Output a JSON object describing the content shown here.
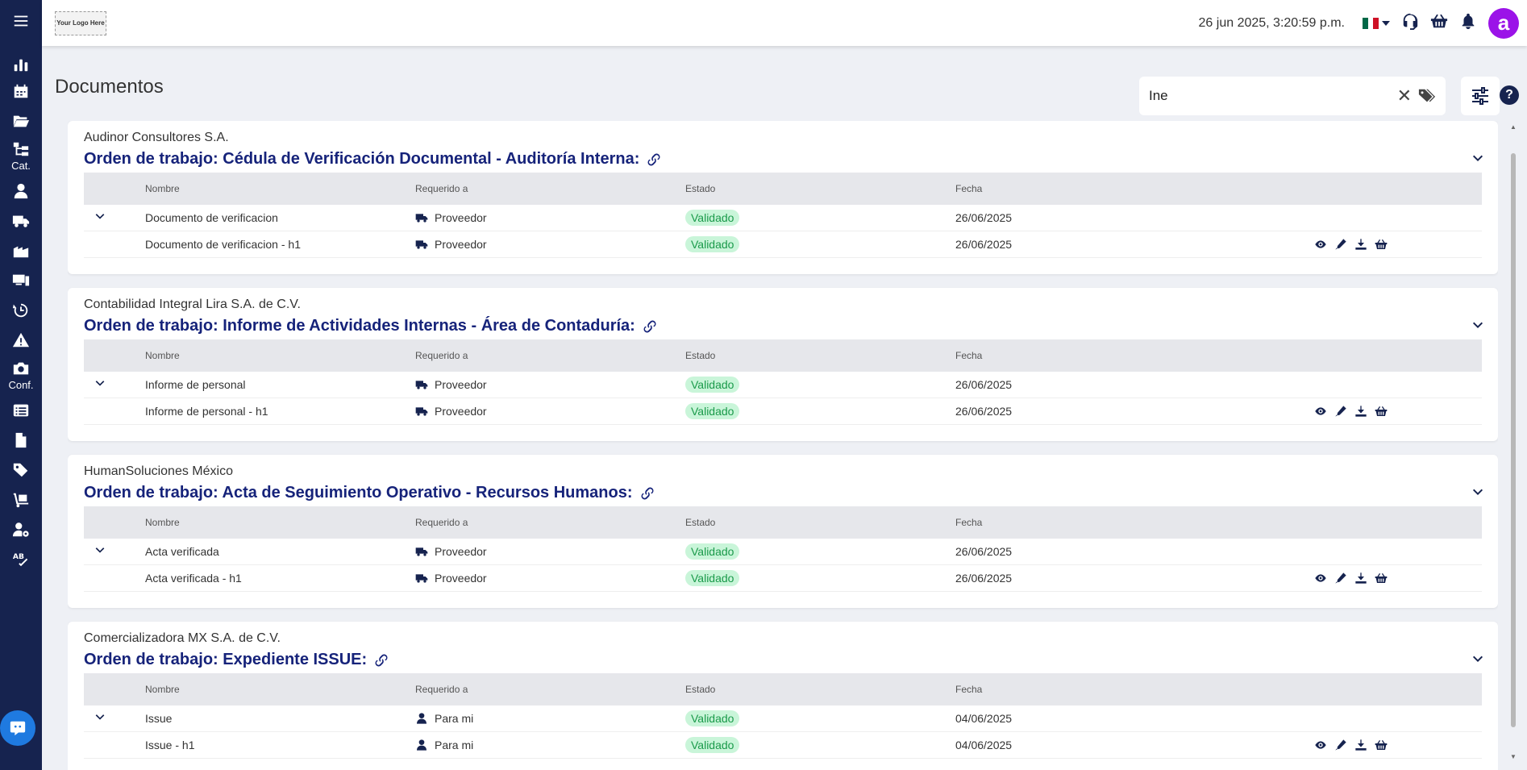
{
  "header": {
    "logo_text": "Your Logo Here",
    "datetime": "26 jun 2025, 3:20:59 p.m.",
    "flag_colors": [
      "#006847",
      "#ffffff",
      "#ce1126"
    ],
    "avatar_letter": "a",
    "avatar_color": "#9b13e8"
  },
  "sidebar": {
    "items": [
      {
        "icon": "menu-icon"
      },
      {
        "icon": "bar-chart-icon"
      },
      {
        "icon": "calendar-icon"
      },
      {
        "icon": "folder-open-icon"
      },
      {
        "icon": "sitemap-icon",
        "label": "Cat."
      },
      {
        "icon": "user-icon"
      },
      {
        "icon": "truck-icon"
      },
      {
        "icon": "building-icon"
      },
      {
        "icon": "devices-icon"
      },
      {
        "icon": "history-icon"
      },
      {
        "icon": "warning-icon"
      },
      {
        "icon": "camera-icon",
        "label": "Conf."
      },
      {
        "icon": "list-icon"
      },
      {
        "icon": "file-icon"
      },
      {
        "icon": "tags-icon"
      },
      {
        "icon": "dolly-icon"
      },
      {
        "icon": "user-gear-icon"
      },
      {
        "icon": "spellcheck-icon"
      }
    ]
  },
  "page": {
    "title": "Documentos"
  },
  "search": {
    "value": "Ine"
  },
  "columns": {
    "name": "Nombre",
    "required": "Requerido a",
    "state": "Estado",
    "date": "Fecha"
  },
  "cards": [
    {
      "company": "Audinor Consultores S.A.",
      "title": "Orden de trabajo: Cédula de Verificación Documental - Auditoría Interna:",
      "rows": [
        {
          "name": "Documento de verificacion",
          "required": "Proveedor",
          "required_icon": "truck-icon",
          "state": "Validado",
          "date": "26/06/2025",
          "toggle": true
        },
        {
          "name": "Documento de verificacion - h1",
          "required": "Proveedor",
          "required_icon": "truck-icon",
          "state": "Validado",
          "date": "26/06/2025",
          "actions": true
        }
      ]
    },
    {
      "company": "Contabilidad Integral Lira S.A. de C.V.",
      "title": "Orden de trabajo: Informe de Actividades Internas - Área de Contaduría:",
      "rows": [
        {
          "name": "Informe de personal",
          "required": "Proveedor",
          "required_icon": "truck-icon",
          "state": "Validado",
          "date": "26/06/2025",
          "toggle": true
        },
        {
          "name": "Informe de personal - h1",
          "required": "Proveedor",
          "required_icon": "truck-icon",
          "state": "Validado",
          "date": "26/06/2025",
          "actions": true
        }
      ]
    },
    {
      "company": "HumanSoluciones México",
      "title": "Orden de trabajo: Acta de Seguimiento Operativo - Recursos Humanos:",
      "rows": [
        {
          "name": "Acta verificada",
          "required": "Proveedor",
          "required_icon": "truck-icon",
          "state": "Validado",
          "date": "26/06/2025",
          "toggle": true
        },
        {
          "name": "Acta verificada - h1",
          "required": "Proveedor",
          "required_icon": "truck-icon",
          "state": "Validado",
          "date": "26/06/2025",
          "actions": true
        }
      ]
    },
    {
      "company": "Comercializadora MX S.A. de C.V.",
      "title": "Orden de trabajo: Expediente ISSUE:",
      "rows": [
        {
          "name": "Issue",
          "required": "Para mi",
          "required_icon": "user-icon",
          "state": "Validado",
          "date": "04/06/2025",
          "toggle": true
        },
        {
          "name": "Issue - h1",
          "required": "Para mi",
          "required_icon": "user-icon",
          "state": "Validado",
          "date": "04/06/2025",
          "actions": true
        }
      ]
    }
  ],
  "row_actions": [
    "eye-icon",
    "pen-icon",
    "download-icon",
    "basket-icon"
  ]
}
